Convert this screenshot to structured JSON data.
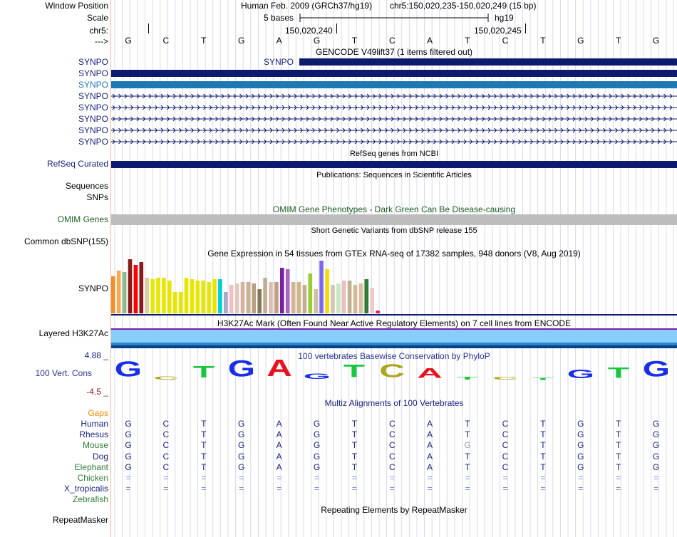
{
  "header": {
    "assembly": "Human Feb. 2009 (GRCh37/hg19)",
    "position": "chr5:150,020,235-150,020,249 (15 bp)",
    "scale_label": "5 bases",
    "scale_db": "hg19",
    "coord_a": "150,020,240",
    "coord_b": "150,020,245"
  },
  "left_labels": {
    "window_position": "Window Position",
    "scale": "Scale",
    "chrom": "chr5:",
    "arrow": "--->",
    "synpo": "SYNPO",
    "refseq": "RefSeq Curated",
    "sequences": "Sequences",
    "snps": "SNPs",
    "omim": "OMIM Genes",
    "common_dbsnp": "Common dbSNP(155)",
    "gtex": "SYNPO",
    "h3k27ac": "Layered H3K27Ac",
    "cons_max": "4.88 _",
    "cons_label": "100 Vert. Cons",
    "cons_min": "-4.5 _",
    "gaps": "Gaps",
    "repeatmasker": "RepeatMasker"
  },
  "bases": [
    "G",
    "C",
    "T",
    "G",
    "A",
    "G",
    "T",
    "C",
    "A",
    "T",
    "C",
    "T",
    "G",
    "T",
    "G"
  ],
  "gencode": {
    "title": "GENCODE V49lift37 (1 items filtered out)",
    "track_gene": "SYNPO",
    "row_labels": [
      "SYNPO",
      "SYNPO",
      "SYNPO",
      "SYNPO",
      "SYNPO",
      "SYNPO",
      "SYNPO"
    ]
  },
  "titles": {
    "refseq": "RefSeq genes from NCBI",
    "publications": "Publications: Sequences in Scientific Articles",
    "omim": "OMIM Gene Phenotypes - Dark Green Can Be Disease-causing",
    "dbsnp": "Short Genetic Variants from dbSNP release 155",
    "gtex": "Gene Expression in 54 tissues from GTEx RNA-seq of 17382 samples, 948 donors (V8, Aug 2019)",
    "h3k27ac": "H3K27Ac Mark (Often Found Near Active Regulatory Elements) on 7 cell lines from ENCODE",
    "phylop": "100 vertebrates Basewise Conservation by PhyloP",
    "multiz": "Multiz Alignments of 100 Vertebrates",
    "repeatmasker": "Repeating Elements by RepeatMasker"
  },
  "conservation": [
    {
      "base": "G",
      "value": 4.2,
      "color": "#1a2ee8"
    },
    {
      "base": "C",
      "value": 0.9,
      "color": "#b0a418"
    },
    {
      "base": "T",
      "value": 3.2,
      "color": "#18c73e"
    },
    {
      "base": "G",
      "value": 4.4,
      "color": "#1a2ee8"
    },
    {
      "base": "A",
      "value": 4.6,
      "color": "#e8121e"
    },
    {
      "base": "G",
      "value": 1.5,
      "color": "#1a2ee8"
    },
    {
      "base": "T",
      "value": 3.4,
      "color": "#18c73e"
    },
    {
      "base": "C",
      "value": 3.6,
      "color": "#b0a418"
    },
    {
      "base": "A",
      "value": 2.6,
      "color": "#e8121e"
    },
    {
      "base": "T",
      "value": 0.8,
      "color": "#18c73e"
    },
    {
      "base": "C",
      "value": 0.7,
      "color": "#b0a418"
    },
    {
      "base": "T",
      "value": 0.5,
      "color": "#18c73e"
    },
    {
      "base": "G",
      "value": 2.4,
      "color": "#1a2ee8"
    },
    {
      "base": "T",
      "value": 2.9,
      "color": "#18c73e"
    },
    {
      "base": "G",
      "value": 4.3,
      "color": "#1a2ee8"
    }
  ],
  "alignments": [
    {
      "species": "Human",
      "color": "#1a237e",
      "bases": [
        "G",
        "C",
        "T",
        "G",
        "A",
        "G",
        "T",
        "C",
        "A",
        "T",
        "C",
        "T",
        "G",
        "T",
        "G"
      ]
    },
    {
      "species": "Rhesus",
      "color": "#1a237e",
      "bases": [
        "G",
        "C",
        "T",
        "G",
        "A",
        "G",
        "T",
        "C",
        "A",
        "T",
        "C",
        "T",
        "G",
        "T",
        "G"
      ]
    },
    {
      "species": "Mouse",
      "color": "#2e7d32",
      "bases": [
        "G",
        "C",
        "T",
        "G",
        "A",
        "G",
        "T",
        "C",
        "A",
        "G",
        "C",
        "T",
        "G",
        "T",
        "G"
      ]
    },
    {
      "species": "Dog",
      "color": "#1a237e",
      "bases": [
        "G",
        "C",
        "T",
        "G",
        "A",
        "G",
        "T",
        "C",
        "A",
        "T",
        "C",
        "T",
        "G",
        "T",
        "G"
      ]
    },
    {
      "species": "Elephant",
      "color": "#2e7d32",
      "bases": [
        "G",
        "C",
        "T",
        "G",
        "A",
        "G",
        "T",
        "C",
        "A",
        "T",
        "C",
        "T",
        "G",
        "T",
        "G"
      ]
    },
    {
      "species": "Chicken",
      "color": "#2e7d32",
      "bases": [
        "=",
        "=",
        "=",
        "=",
        "=",
        "=",
        "=",
        "=",
        "=",
        "=",
        "=",
        "=",
        "=",
        "=",
        "="
      ]
    },
    {
      "species": "X_tropicalis",
      "color": "#1a237e",
      "bases": [
        "=",
        "=",
        "=",
        "=",
        "=",
        "=",
        "=",
        "=",
        "=",
        "=",
        "=",
        "=",
        "=",
        "=",
        "="
      ]
    },
    {
      "species": "Zebrafish",
      "color": "#2e7d32",
      "bases": [
        "",
        "",
        "",
        "",
        "",
        "",
        "",
        "",
        "",
        "",
        "",
        "",
        "",
        "",
        ""
      ]
    }
  ],
  "gtex_colors": {
    "orange": "#f28e2b",
    "darkred": "#8b1a1a",
    "yellow": "#e6e600",
    "purple": "#7b68ee",
    "pink": "#e91e63"
  }
}
